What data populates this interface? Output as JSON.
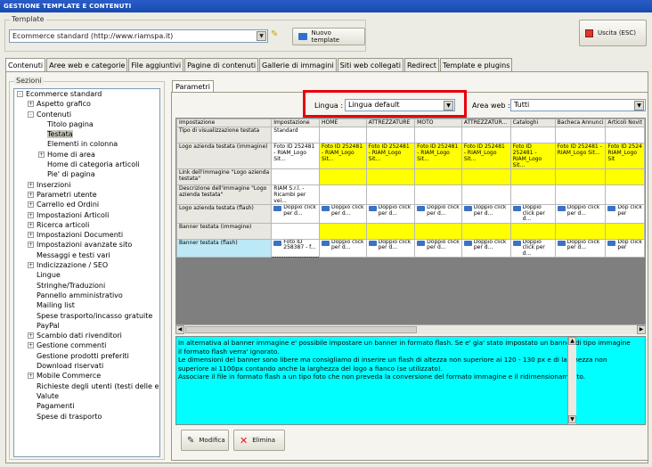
{
  "window": {
    "title": "GESTIONE TEMPLATE E CONTENUTI"
  },
  "template_group": {
    "label": "Template",
    "selected": "Ecommerce standard (http://www.riamspa.it)",
    "new_button": "Nuovo template"
  },
  "exit_button": "Uscita (ESC)",
  "tabs": [
    "Contenuti",
    "Aree web e categorie",
    "File aggiuntivi",
    "Pagine di contenuti",
    "Gallerie di immagini",
    "Siti web collegati",
    "Redirect",
    "Template e plugins"
  ],
  "sections": {
    "label": "Sezioni",
    "tree": [
      {
        "label": "Ecommerce standard",
        "level": 0,
        "exp": "-"
      },
      {
        "label": "Aspetto grafico",
        "level": 1,
        "exp": "+"
      },
      {
        "label": "Contenuti",
        "level": 1,
        "exp": "-"
      },
      {
        "label": "Titolo pagina",
        "level": 2,
        "exp": ""
      },
      {
        "label": "Testata",
        "level": 2,
        "exp": "",
        "selected": true
      },
      {
        "label": "Elementi in colonna",
        "level": 2,
        "exp": ""
      },
      {
        "label": "Home di area",
        "level": 2,
        "exp": "+"
      },
      {
        "label": "Home di categoria articoli",
        "level": 2,
        "exp": ""
      },
      {
        "label": "Pie' di pagina",
        "level": 2,
        "exp": ""
      },
      {
        "label": "Inserzioni",
        "level": 1,
        "exp": "+"
      },
      {
        "label": "Parametri utente",
        "level": 1,
        "exp": "+"
      },
      {
        "label": "Carrello ed Ordini",
        "level": 1,
        "exp": "+"
      },
      {
        "label": "Impostazioni Articoli",
        "level": 1,
        "exp": "+"
      },
      {
        "label": "Ricerca articoli",
        "level": 1,
        "exp": "+"
      },
      {
        "label": "Impostazioni Documenti",
        "level": 1,
        "exp": "+"
      },
      {
        "label": "Impostazioni avanzate sito",
        "level": 1,
        "exp": "+"
      },
      {
        "label": "Messaggi e testi vari",
        "level": 1,
        "exp": ""
      },
      {
        "label": "Indicizzazione / SEO",
        "level": 1,
        "exp": "+"
      },
      {
        "label": "Lingue",
        "level": 1,
        "exp": ""
      },
      {
        "label": "Stringhe/Traduzioni",
        "level": 1,
        "exp": ""
      },
      {
        "label": "Pannello amministrativo",
        "level": 1,
        "exp": ""
      },
      {
        "label": "Mailing list",
        "level": 1,
        "exp": ""
      },
      {
        "label": "Spese trasporto/incasso gratuite",
        "level": 1,
        "exp": ""
      },
      {
        "label": "PayPal",
        "level": 1,
        "exp": ""
      },
      {
        "label": "Scambio dati rivenditori",
        "level": 1,
        "exp": "+"
      },
      {
        "label": "Gestione commenti",
        "level": 1,
        "exp": "+"
      },
      {
        "label": "Gestione prodotti preferiti",
        "level": 1,
        "exp": ""
      },
      {
        "label": "Download riservati",
        "level": 1,
        "exp": ""
      },
      {
        "label": "Mobile Commerce",
        "level": 1,
        "exp": "+"
      },
      {
        "label": "Richieste degli utenti (testi delle email)",
        "level": 1,
        "exp": ""
      },
      {
        "label": "Valute",
        "level": 1,
        "exp": ""
      },
      {
        "label": "Pagamenti",
        "level": 1,
        "exp": ""
      },
      {
        "label": "Spese di trasporto",
        "level": 1,
        "exp": ""
      }
    ]
  },
  "params_tab": "Parametri",
  "lingua": {
    "label": "Lingua :",
    "value": "Lingua default"
  },
  "area_web": {
    "label": "Area web :",
    "value": "Tutti"
  },
  "grid": {
    "columns": [
      "Impostazione",
      "Impostazione",
      "HOME",
      "ATTREZZATURE",
      "MOTO",
      "ATTREZZATUR...",
      "Cataloghi",
      "Bacheca Annunci",
      "Articoli Novit"
    ],
    "rows": [
      {
        "name": "Tipo di visualizzazione testata",
        "default": "Standard",
        "kind": "text",
        "areas": [
          "",
          "",
          "",
          "",
          "",
          "",
          ""
        ]
      },
      {
        "name": "Logo azienda testata (immagine)",
        "default": "Foto ID 252481 - RIAM_Logo Sit...",
        "kind": "yellow",
        "areas": [
          "Foto ID 252481 - RIAM_Logo Sit...",
          "Foto ID 252481 - RIAM_Logo Sit...",
          "Foto ID 252481 - RIAM_Logo Sit...",
          "Foto ID 252481 - RIAM_Logo Sit...",
          "Foto ID 252481 - RIAM_Logo Sit...",
          "Foto ID 252481 - RIAM_Logo Sit...",
          "Foto ID 2524 RIAM_Logo Sit"
        ]
      },
      {
        "name": "Link dell'immagine \"Logo azienda testata\"",
        "default": "",
        "kind": "yellow",
        "areas": [
          "",
          "",
          "",
          "",
          "",
          "",
          ""
        ]
      },
      {
        "name": "Descrizione dell'immagine \"Logo azienda testata\"",
        "default": "RIAM S.r.l. - Ricambi per vei...",
        "kind": "text",
        "areas": [
          "",
          "",
          "",
          "",
          "",
          "",
          ""
        ]
      },
      {
        "name": "Logo azienda testata (flash)",
        "default": "Doppio click per d...",
        "kind": "flash",
        "areas": [
          "Doppio click per d...",
          "Doppio click per d...",
          "Doppio click per d...",
          "Doppio click per d...",
          "Doppio click per d...",
          "Doppio click per d...",
          "Dop click per"
        ]
      },
      {
        "name": "Banner testata (immagine)",
        "default": "",
        "kind": "yellow",
        "areas": [
          "",
          "",
          "",
          "",
          "",
          "",
          ""
        ]
      },
      {
        "name": "Banner testata (flash)",
        "default": "Foto ID 258387 - f...",
        "kind": "flash",
        "highlight": true,
        "areas": [
          "Doppio click per d...",
          "Doppio click per d...",
          "Doppio click per d...",
          "Doppio click per d...",
          "Doppio click per d...",
          "Doppio click per d...",
          "Dop click per"
        ]
      }
    ]
  },
  "description": [
    "In alternativa al banner immagine e' possibile impostare un banner in formato flash. Se e' gia' stato impostato un banner di tipo immagine il formato flash verra' ignorato.",
    "Le dimensioni del banner sono libere ma consigliamo di inserire un flash di altezza non superiore ai 120 - 130 px e di larghezza non superiore ai 1100px contando anche la larghezza del logo a fianco (se utilizzato).",
    "Associare il file in formato flash a un tipo foto che non preveda la conversione del formato immagine e il ridimensionamento."
  ],
  "buttons": {
    "edit": "Modifica",
    "delete": "Elimina"
  }
}
